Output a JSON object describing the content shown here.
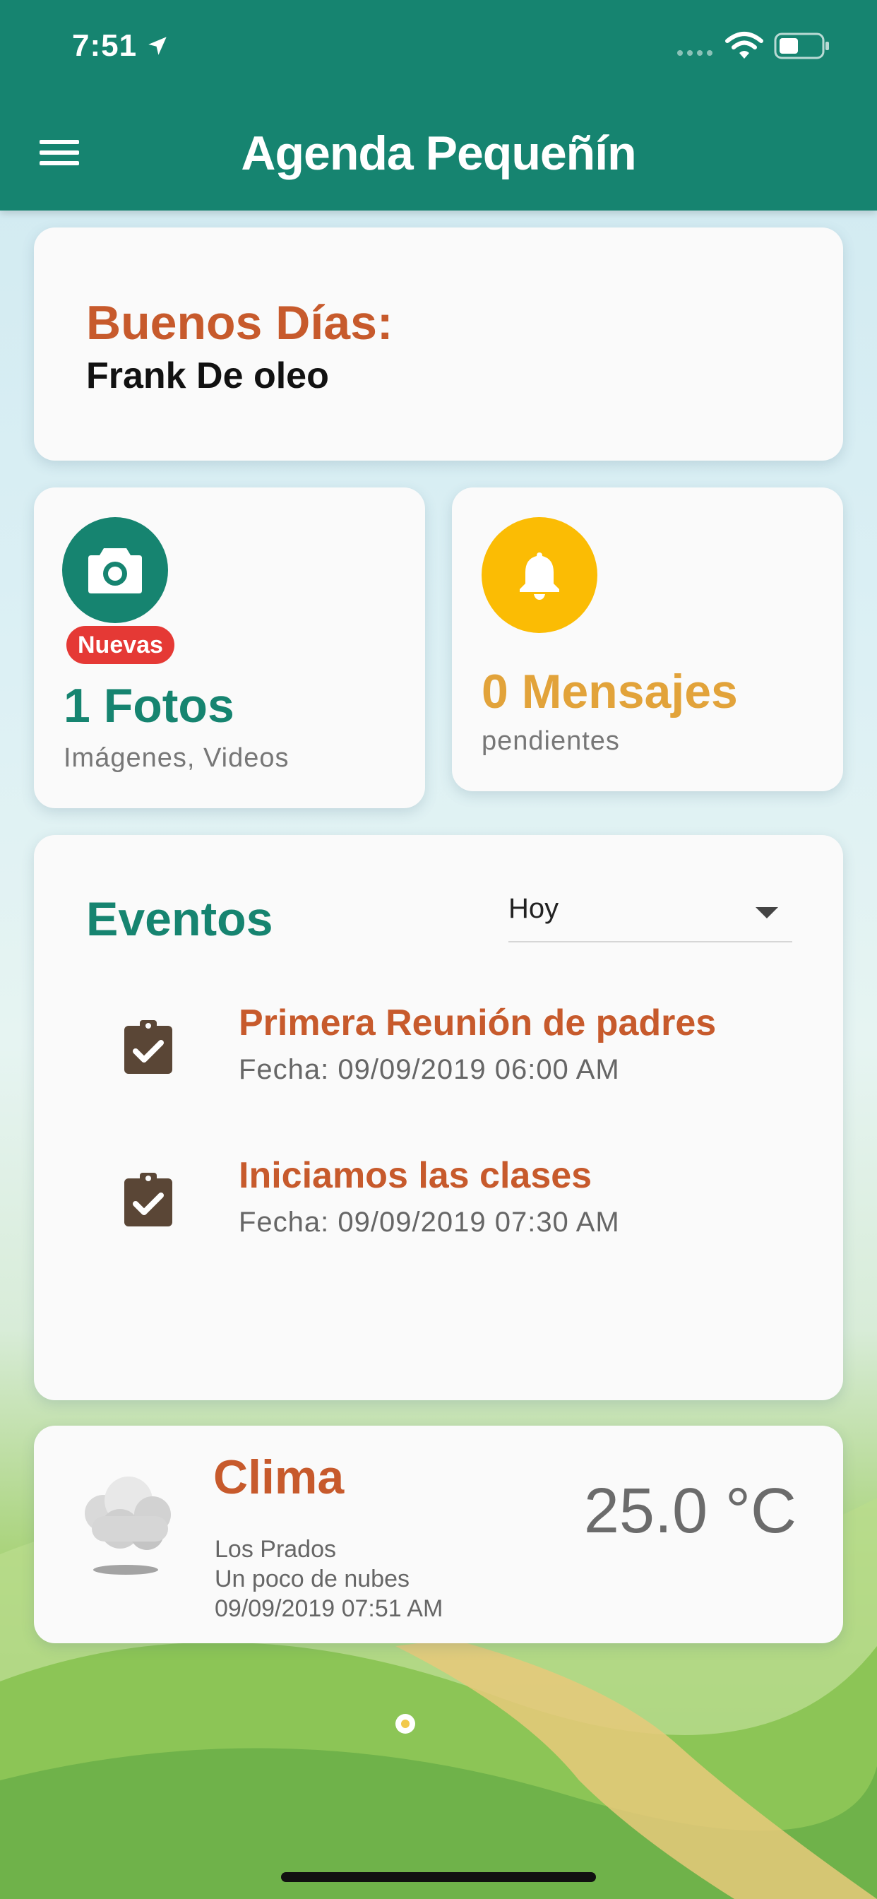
{
  "status_bar": {
    "time": "7:51",
    "icons": [
      "location-arrow-icon",
      "signal-icon",
      "wifi-icon",
      "battery-icon"
    ]
  },
  "header": {
    "title": "Agenda Pequeñín",
    "menu_icon": "hamburger-menu-icon",
    "background_color": "#168470"
  },
  "greeting": {
    "title": "Buenos Días:",
    "name": "Frank De oleo"
  },
  "photos": {
    "icon": "camera-icon",
    "badge": "Nuevas",
    "count_label": "1 Fotos",
    "subtitle": "Imágenes, Videos"
  },
  "messages": {
    "icon": "bell-icon",
    "count_label": "0 Mensajes",
    "subtitle": "pendientes"
  },
  "events": {
    "title": "Eventos",
    "filter": {
      "selected": "Hoy"
    },
    "items": [
      {
        "title": "Primera Reunión de padres",
        "date": "Fecha: 09/09/2019 06:00 AM",
        "icon": "clipboard-check-icon"
      },
      {
        "title": "Iniciamos las clases",
        "date": "Fecha: 09/09/2019 07:30 AM",
        "icon": "clipboard-check-icon"
      }
    ]
  },
  "weather": {
    "title": "Clima",
    "location": "Los Prados",
    "condition": "Un poco de nubes",
    "updated": "09/09/2019 07:51 AM",
    "temperature": "25.0 °C",
    "icon": "cloud-icon"
  },
  "colors": {
    "accent_green": "#168470",
    "accent_orange": "#c75a2c",
    "accent_yellow": "#fbbc04",
    "badge_red": "#e53935"
  }
}
